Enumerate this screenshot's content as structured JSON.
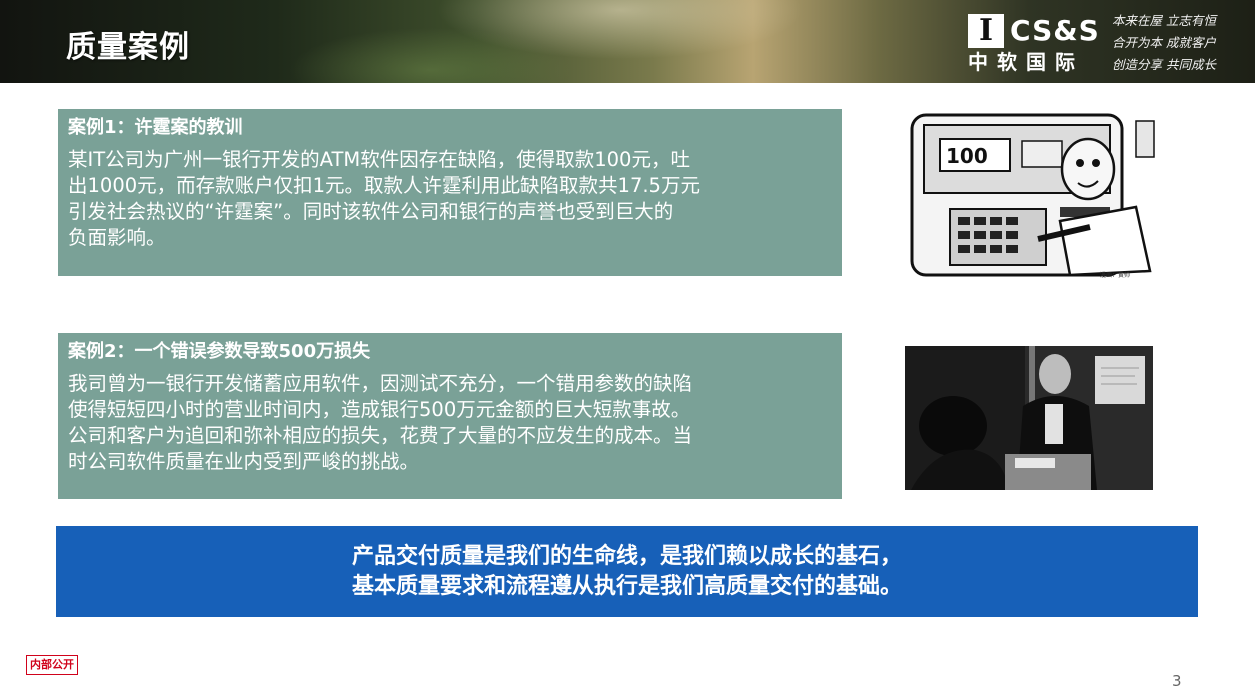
{
  "header": {
    "title": "质量案例",
    "logo": {
      "mark": "I",
      "brand": "CS&S",
      "name_cn": "中软国际"
    },
    "motto": [
      "本来在屋  立志有恒",
      "合开为本  成就客户",
      "创造分享  共同成长"
    ]
  },
  "case1": {
    "title": "案例1：许霆案的教训",
    "body_lines": [
      "某IT公司为广州一银行开发的ATM软件因存在缺陷，使得取款100元，吐",
      "出1000元，而存款账户仅扣1元。取款人许霆利用此缺陷取款共17.5万元",
      "引发社会热议的“许霆案”。同时该软件公司和银行的声誉也受到巨大的",
      "负面影响。"
    ]
  },
  "case2": {
    "title": "案例2：一个错误参数导致500万损失",
    "body_lines": [
      "我司曾为一银行开发储蓄应用软件，因测试不充分，一个错用参数的缺陷",
      "使得短短四小时的营业时间内，造成银行500万元金额的巨大短款事故。",
      "公司和客户为追回和弥补相应的损失，花费了大量的不应发生的成本。当",
      "时公司软件质量在业内受到严峻的挑战。"
    ]
  },
  "images": {
    "atm_caption": "漫画：黄帅",
    "atm_display": "100"
  },
  "banner": {
    "line1": "产品交付质量是我们的生命线，是我们赖以成长的基石，",
    "line2": "基本质量要求和流程遵从执行是我们高质量交付的基础。"
  },
  "footer": {
    "internal_label": "内部公开",
    "page_number": "3"
  },
  "colors": {
    "case_box": "#7aa197",
    "banner": "#1760b8",
    "internal_tag": "#d0021b"
  }
}
